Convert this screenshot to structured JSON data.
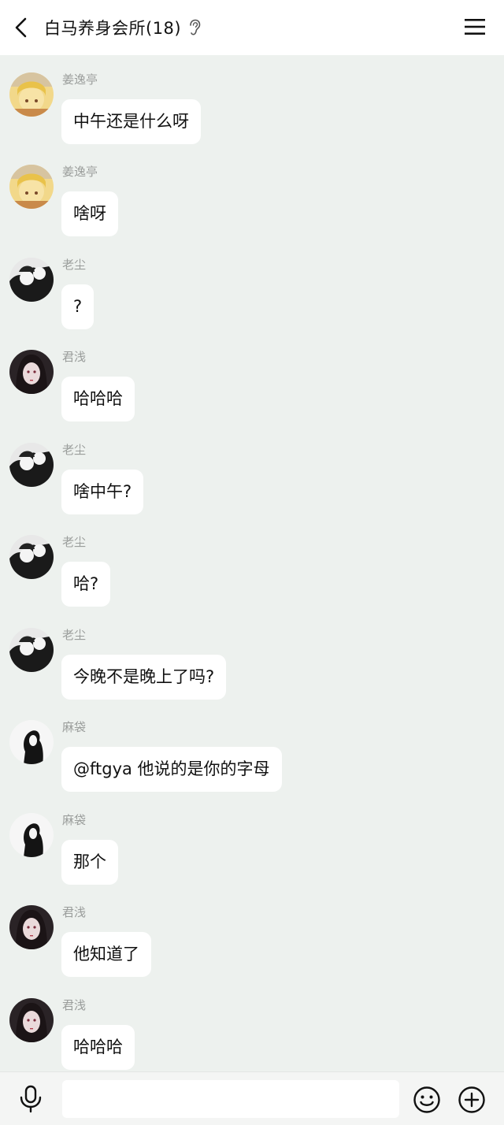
{
  "header": {
    "title": "白马养身会所(18)",
    "back_icon": "chevron-left-icon",
    "ear_icon": "ear-icon",
    "menu_icon": "hamburger-menu-icon"
  },
  "messages": [
    {
      "sender": "姜逸亭",
      "text": "中午还是什么呀",
      "avatar": "anime-blonde-girl"
    },
    {
      "sender": "姜逸亭",
      "text": "啥呀",
      "avatar": "anime-blonde-girl"
    },
    {
      "sender": "老尘",
      "text": "?",
      "avatar": "manga-couple-bw"
    },
    {
      "sender": "君浅",
      "text": "哈哈哈",
      "avatar": "anime-dark-hair-girl"
    },
    {
      "sender": "老尘",
      "text": "啥中午?",
      "avatar": "manga-couple-bw"
    },
    {
      "sender": "老尘",
      "text": "哈?",
      "avatar": "manga-couple-bw"
    },
    {
      "sender": "老尘",
      "text": "今晚不是晚上了吗?",
      "avatar": "manga-couple-bw"
    },
    {
      "sender": "麻袋",
      "text": "@ftgya 他说的是你的字母",
      "avatar": "bw-silhouette-boy"
    },
    {
      "sender": "麻袋",
      "text": "那个",
      "avatar": "bw-silhouette-boy"
    },
    {
      "sender": "君浅",
      "text": "他知道了",
      "avatar": "anime-dark-hair-girl"
    },
    {
      "sender": "君浅",
      "text": "哈哈哈",
      "avatar": "anime-dark-hair-girl"
    }
  ],
  "input_bar": {
    "value": "",
    "mic_icon": "microphone-icon",
    "emoji_icon": "smiley-icon",
    "plus_icon": "plus-circle-icon"
  },
  "colors": {
    "background": "#edf1ee",
    "bubble": "#ffffff",
    "sender_text": "#9a9d9b"
  }
}
